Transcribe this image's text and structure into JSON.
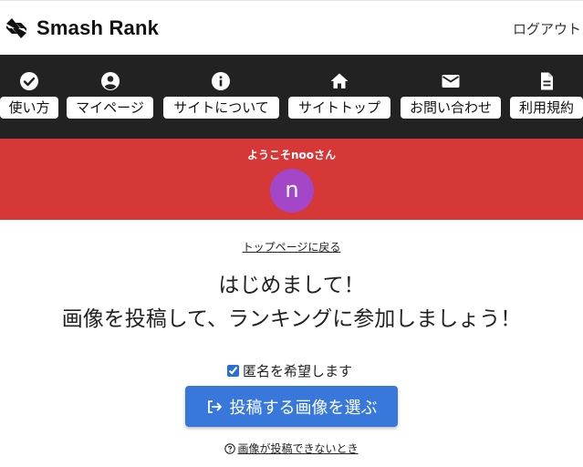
{
  "header": {
    "logo_text": "Smash Rank",
    "logout_label": "ログアウト"
  },
  "nav": {
    "items": [
      {
        "label": "使い方",
        "icon": "check-circle-icon"
      },
      {
        "label": "マイページ",
        "icon": "account-circle-icon"
      },
      {
        "label": "サイトについて",
        "icon": "info-icon"
      },
      {
        "label": "サイトトップ",
        "icon": "home-icon"
      },
      {
        "label": "お問い合わせ",
        "icon": "mail-icon"
      },
      {
        "label": "利用規約",
        "icon": "document-icon"
      }
    ]
  },
  "banner": {
    "welcome": "ようこそnooさん",
    "avatar_initial": "n",
    "color": "#d63737",
    "avatar_color": "#a346c8"
  },
  "main": {
    "back_link": "トップページに戻る",
    "heading_line1": "はじめまして！",
    "heading_line2": "画像を投稿して、ランキングに参加しましょう！",
    "anonymous_label": "匿名を希望します",
    "anonymous_checked": true,
    "upload_button": "投稿する画像を選ぶ",
    "upload_button_color": "#3878db",
    "help_link": "画像が投稿できないとき"
  }
}
